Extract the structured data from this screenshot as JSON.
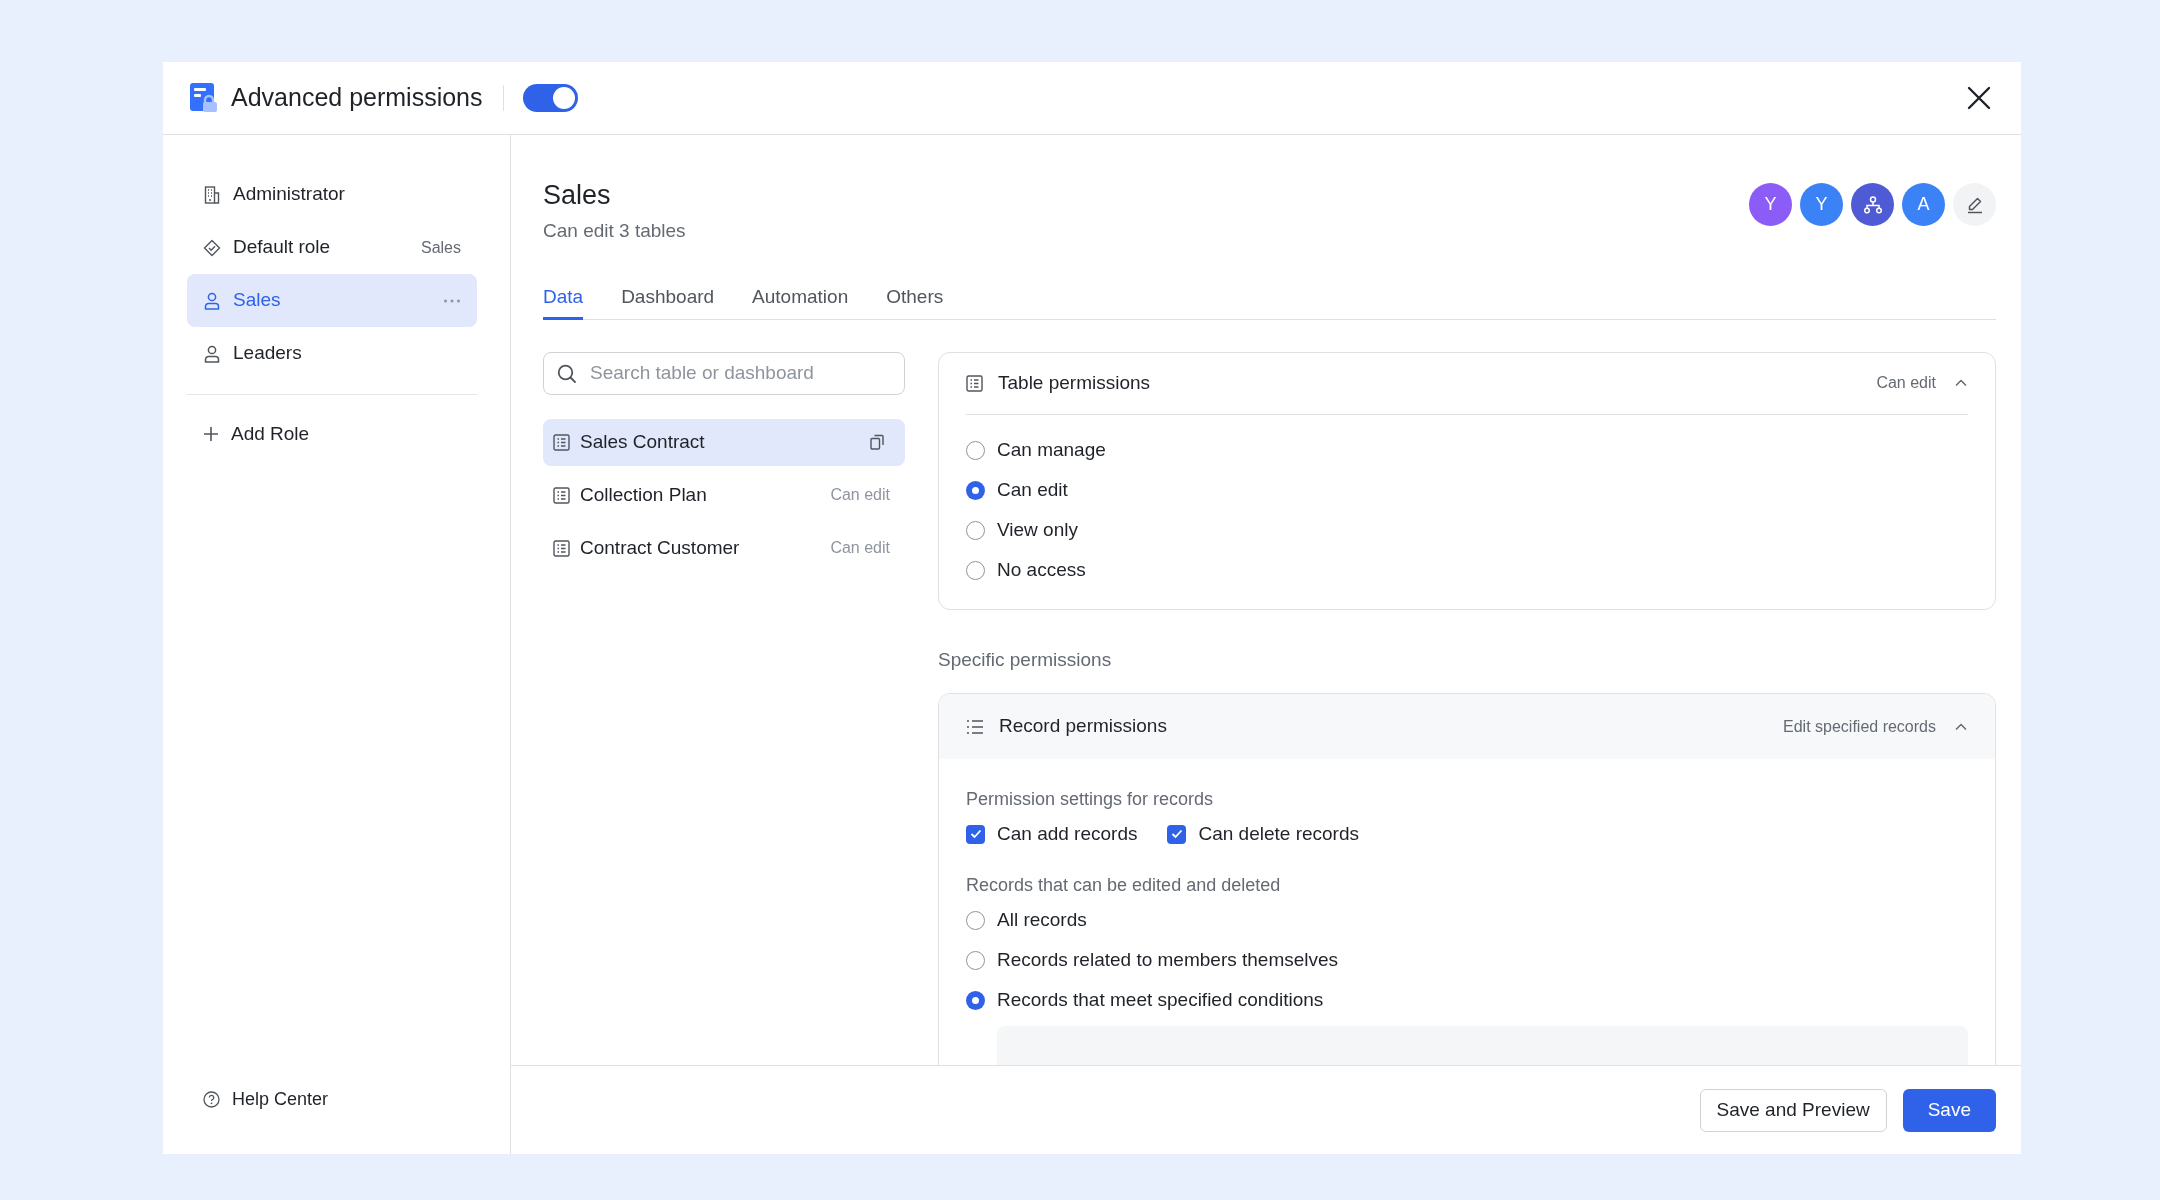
{
  "header": {
    "title": "Advanced permissions",
    "enabled": true
  },
  "sidebar": {
    "roles": [
      {
        "label": "Administrator",
        "selected": false
      },
      {
        "label": "Default role",
        "value": "Sales",
        "selected": false
      },
      {
        "label": "Sales",
        "selected": true
      },
      {
        "label": "Leaders",
        "selected": false
      }
    ],
    "add_role": "Add Role",
    "help": "Help Center"
  },
  "role": {
    "title": "Sales",
    "subtitle": "Can edit 3 tables",
    "members": [
      {
        "kind": "person",
        "initial": "Y",
        "color": "#8b5cf6"
      },
      {
        "kind": "person",
        "initial": "Y",
        "color": "#3b82f6"
      },
      {
        "kind": "group",
        "color": "#4f5bd5"
      },
      {
        "kind": "person",
        "initial": "A",
        "color": "#3b82f6"
      }
    ]
  },
  "tabs": [
    {
      "label": "Data",
      "selected": true
    },
    {
      "label": "Dashboard",
      "selected": false
    },
    {
      "label": "Automation",
      "selected": false
    },
    {
      "label": "Others",
      "selected": false
    }
  ],
  "search": {
    "placeholder": "Search table or dashboard"
  },
  "tables": [
    {
      "name": "Sales Contract",
      "selected": true
    },
    {
      "name": "Collection Plan",
      "access": "Can edit",
      "selected": false
    },
    {
      "name": "Contract Customer",
      "access": "Can edit",
      "selected": false
    }
  ],
  "table_permissions": {
    "title": "Table permissions",
    "summary": "Can edit",
    "expanded": true,
    "options": [
      {
        "label": "Can manage",
        "selected": false
      },
      {
        "label": "Can edit",
        "selected": true
      },
      {
        "label": "View only",
        "selected": false
      },
      {
        "label": "No access",
        "selected": false
      }
    ]
  },
  "specific_permissions": {
    "label": "Specific permissions",
    "record_permissions": {
      "title": "Record permissions",
      "summary": "Edit specified records",
      "expanded": true,
      "settings_label": "Permission settings for records",
      "checks": [
        {
          "label": "Can add records",
          "checked": true
        },
        {
          "label": "Can delete records",
          "checked": true
        }
      ],
      "records_label": "Records that can be edited and deleted",
      "options": [
        {
          "label": "All records",
          "selected": false
        },
        {
          "label": "Records related to members themselves",
          "selected": false
        },
        {
          "label": "Records that meet specified conditions",
          "selected": true
        }
      ]
    }
  },
  "footer": {
    "buttons": [
      {
        "label": "Save and Preview",
        "kind": "secondary"
      },
      {
        "label": "Save",
        "kind": "primary"
      }
    ]
  }
}
